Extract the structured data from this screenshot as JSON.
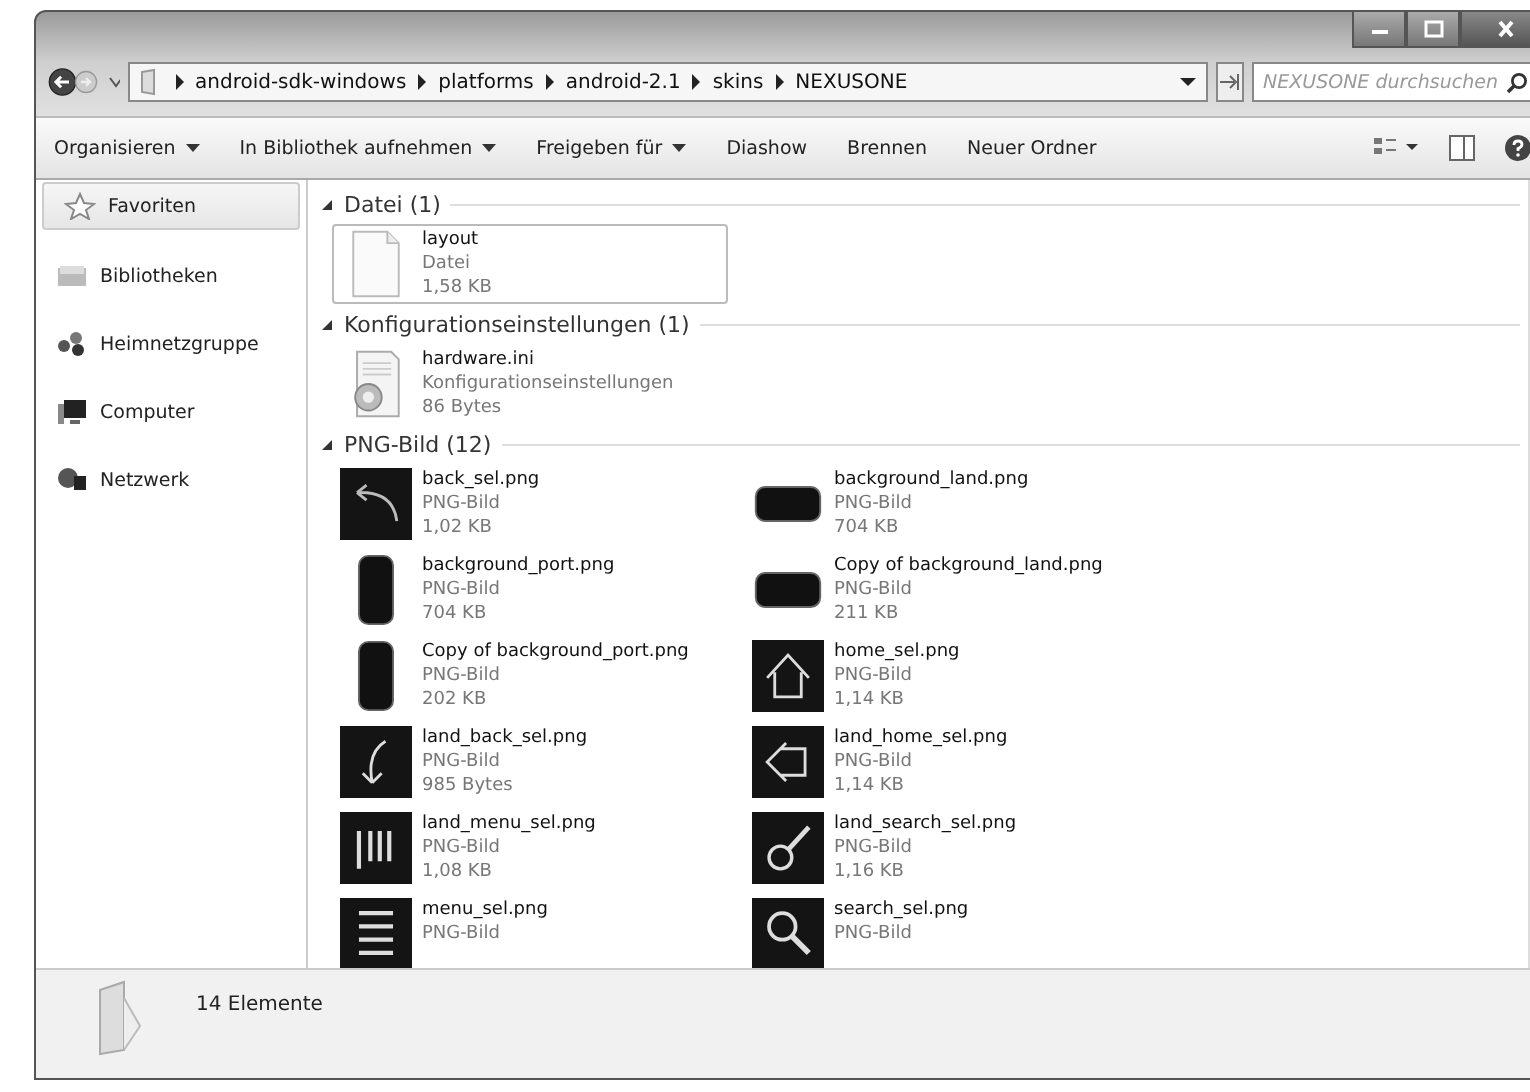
{
  "address": {
    "path": [
      "android-sdk-windows",
      "platforms",
      "android-2.1",
      "skins",
      "NEXUSONE"
    ]
  },
  "search": {
    "placeholder": "NEXUSONE durchsuchen"
  },
  "toolbar": [
    {
      "label": "Organisieren",
      "dropdown": true
    },
    {
      "label": "In Bibliothek aufnehmen",
      "dropdown": true
    },
    {
      "label": "Freigeben für",
      "dropdown": true
    },
    {
      "label": "Diashow",
      "dropdown": false
    },
    {
      "label": "Brennen",
      "dropdown": false
    },
    {
      "label": "Neuer Ordner",
      "dropdown": false
    }
  ],
  "sidebar": [
    {
      "label": "Favoriten",
      "selected": true
    },
    {
      "label": "Bibliotheken",
      "selected": false
    },
    {
      "label": "Heimnetzgruppe",
      "selected": false
    },
    {
      "label": "Computer",
      "selected": false
    },
    {
      "label": "Netzwerk",
      "selected": false
    }
  ],
  "groups": [
    {
      "title": "Datei (1)",
      "expanded": true,
      "items": [
        {
          "name": "layout",
          "type": "Datei",
          "size": "1,58 KB",
          "kind": "file",
          "selected": true
        }
      ]
    },
    {
      "title": "Konfigurationseinstellungen (1)",
      "expanded": true,
      "items": [
        {
          "name": "hardware.ini",
          "type": "Konfigurationseinstellungen",
          "size": "86 Bytes",
          "kind": "config",
          "selected": false
        }
      ]
    },
    {
      "title": "PNG-Bild (12)",
      "expanded": true,
      "items": [
        {
          "name": "back_sel.png",
          "type": "PNG-Bild",
          "size": "1,02 KB",
          "kind": "back",
          "selected": false
        },
        {
          "name": "background_land.png",
          "type": "PNG-Bild",
          "size": "704 KB",
          "kind": "land",
          "selected": false
        },
        {
          "name": "background_port.png",
          "type": "PNG-Bild",
          "size": "704 KB",
          "kind": "port",
          "selected": false
        },
        {
          "name": "Copy of background_land.png",
          "type": "PNG-Bild",
          "size": "211 KB",
          "kind": "land",
          "selected": false
        },
        {
          "name": "Copy of background_port.png",
          "type": "PNG-Bild",
          "size": "202 KB",
          "kind": "port",
          "selected": false
        },
        {
          "name": "home_sel.png",
          "type": "PNG-Bild",
          "size": "1,14 KB",
          "kind": "home",
          "selected": false
        },
        {
          "name": "land_back_sel.png",
          "type": "PNG-Bild",
          "size": "985 Bytes",
          "kind": "landback",
          "selected": false
        },
        {
          "name": "land_home_sel.png",
          "type": "PNG-Bild",
          "size": "1,14 KB",
          "kind": "landhome",
          "selected": false
        },
        {
          "name": "land_menu_sel.png",
          "type": "PNG-Bild",
          "size": "1,08 KB",
          "kind": "landmenu",
          "selected": false
        },
        {
          "name": "land_search_sel.png",
          "type": "PNG-Bild",
          "size": "1,16 KB",
          "kind": "landsearch",
          "selected": false
        },
        {
          "name": "menu_sel.png",
          "type": "PNG-Bild",
          "kind": "menu",
          "selected": false
        },
        {
          "name": "search_sel.png",
          "type": "PNG-Bild",
          "kind": "search",
          "selected": false
        }
      ]
    }
  ],
  "status": {
    "count": "14 Elemente"
  }
}
